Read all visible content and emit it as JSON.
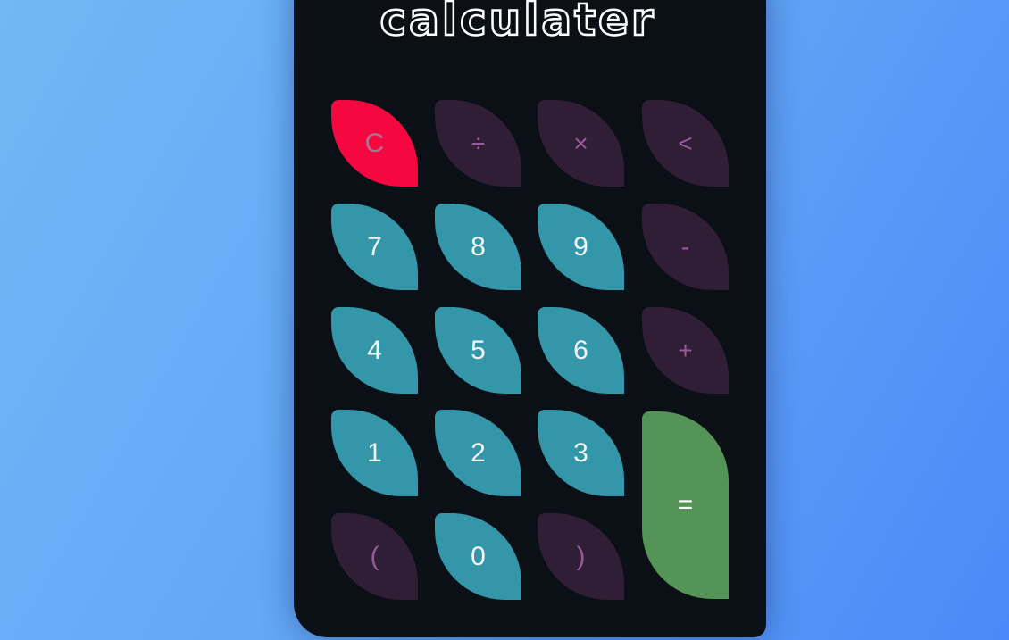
{
  "app": {
    "title": "calculater"
  },
  "keypad": {
    "clear": "C",
    "divide": "÷",
    "multiply": "×",
    "backspace": "<",
    "seven": "7",
    "eight": "8",
    "nine": "9",
    "minus": "-",
    "four": "4",
    "five": "5",
    "six": "6",
    "plus": "+",
    "one": "1",
    "two": "2",
    "three": "3",
    "equals": "=",
    "open_paren": "(",
    "zero": "0",
    "close_paren": ")"
  },
  "colors": {
    "background_start": "#71b8f5",
    "background_end": "#4a8af8",
    "panel": "#0a1016",
    "clear_key": "#f4083f",
    "operator_key": "#2f1e36",
    "number_key": "#3496a9",
    "equals_key": "#559457"
  }
}
